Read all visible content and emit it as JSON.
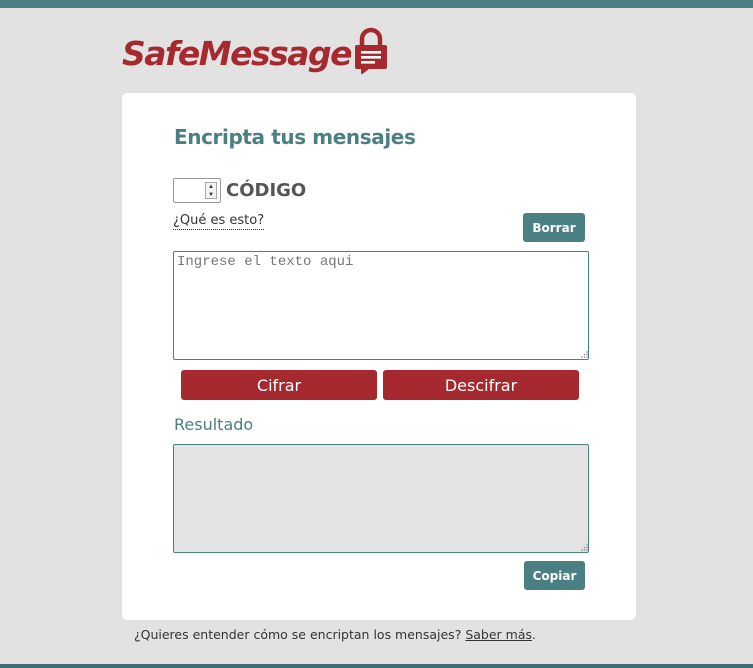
{
  "brand": {
    "logo_text": "SafeMessage",
    "logo_icon": "padlock-icon",
    "primary_color": "#a5292e",
    "accent_color": "#4a7f84"
  },
  "card": {
    "title": "Encripta tus mensajes",
    "code_label": "CÓDIGO",
    "code_value": "",
    "what_link": "¿Qué es esto?",
    "clear_button": "Borrar",
    "input_placeholder": "Ingrese el texto aqui",
    "encrypt_button": "Cifrar",
    "decrypt_button": "Descifrar",
    "result_label": "Resultado",
    "result_value": "",
    "copy_button": "Copiar"
  },
  "footer": {
    "text": "¿Quieres entender cómo se encriptan los mensajes?",
    "link": "Saber más",
    "end": "."
  }
}
